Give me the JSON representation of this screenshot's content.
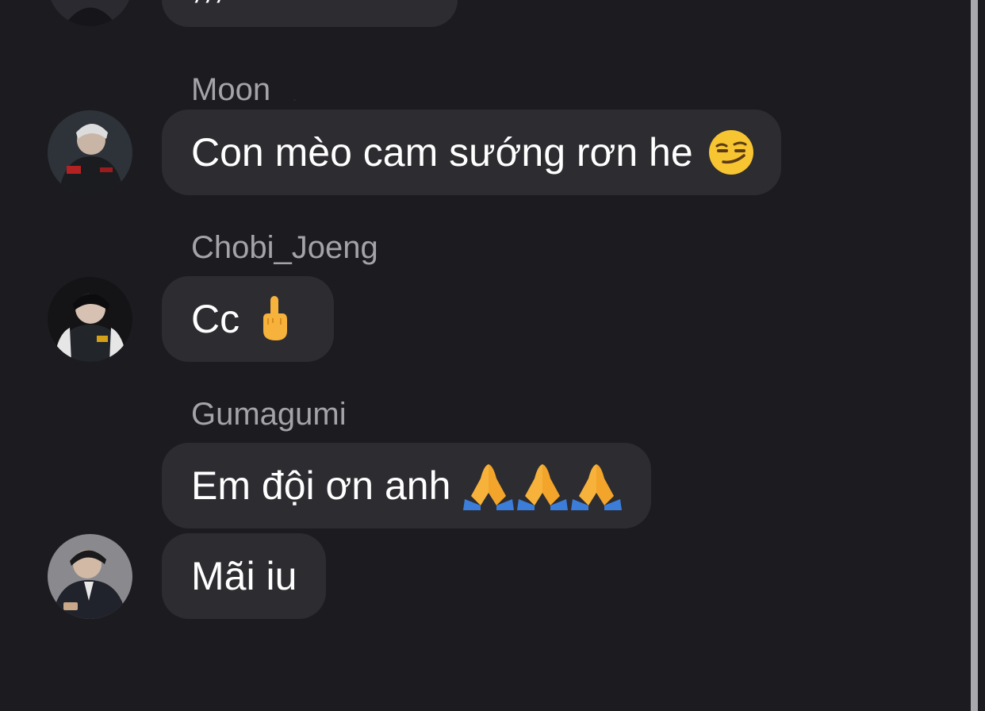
{
  "messages": [
    {
      "sender": "",
      "text": ",,,"
    },
    {
      "sender": "Moon",
      "sender_emoji": "crescent-moon",
      "text": "Con mèo cam sướng rơn he",
      "emoji": "smirking-face"
    },
    {
      "sender": "Chobi_Joeng",
      "text": "Cc",
      "emoji": "middle-finger"
    },
    {
      "sender": "Gumagumi",
      "text": "Em đội ơn anh",
      "emoji": "folded-hands-x3"
    },
    {
      "sender": "",
      "text": "Mãi iu"
    }
  ],
  "colors": {
    "background": "#1c1b20",
    "bubble": "#2d2c31",
    "message_text": "#ffffff",
    "sender_text": "#a3a3a8",
    "scrollbar": "#a9a9ad"
  }
}
